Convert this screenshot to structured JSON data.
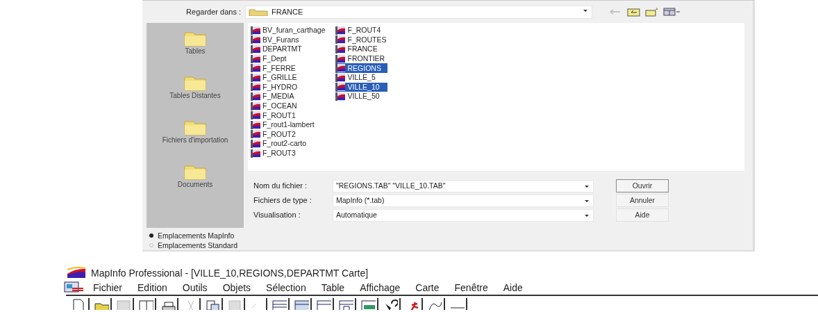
{
  "dialog": {
    "look_in": {
      "label": "Regarder dans :",
      "value": "FRANCE"
    },
    "places": [
      {
        "label": "Tables"
      },
      {
        "label": "Tables Distantes"
      },
      {
        "label": "Fichiers d'importation"
      },
      {
        "label": "Documents"
      }
    ],
    "files": [
      {
        "name": "BV_furan_carthage",
        "selected": false
      },
      {
        "name": "BV_Furans",
        "selected": false
      },
      {
        "name": "DEPARTMT",
        "selected": false
      },
      {
        "name": "F_Dept",
        "selected": false
      },
      {
        "name": "F_FERRE",
        "selected": false
      },
      {
        "name": "F_GRILLE",
        "selected": false
      },
      {
        "name": "F_HYDRO",
        "selected": false
      },
      {
        "name": "F_MEDIA",
        "selected": false
      },
      {
        "name": "F_OCEAN",
        "selected": false
      },
      {
        "name": "F_ROUT1",
        "selected": false
      },
      {
        "name": "F_rout1-lambert",
        "selected": false
      },
      {
        "name": "F_ROUT2",
        "selected": false
      },
      {
        "name": "F_rout2-carto",
        "selected": false
      },
      {
        "name": "F_ROUT3",
        "selected": false
      },
      {
        "name": "F_ROUT4",
        "selected": false
      },
      {
        "name": "F_ROUTES",
        "selected": false
      },
      {
        "name": "FRANCE",
        "selected": false
      },
      {
        "name": "FRONTIER",
        "selected": false
      },
      {
        "name": "REGIONS",
        "selected": true
      },
      {
        "name": "VILLE_5",
        "selected": false
      },
      {
        "name": "VILLE_10",
        "selected": true
      },
      {
        "name": "VILLE_50",
        "selected": false
      }
    ],
    "fields": [
      {
        "label": "Nom du fichier :",
        "value": "\"REGIONS.TAB\" \"VILLE_10.TAB\""
      },
      {
        "label": "Fichiers de type :",
        "value": "MapInfo (*.tab)"
      },
      {
        "label": "Visualisation :",
        "value": "Automatique"
      }
    ],
    "buttons": [
      {
        "label": "Ouvrir",
        "default": true
      },
      {
        "label": "Annuler",
        "default": false
      },
      {
        "label": "Aide",
        "default": false
      }
    ],
    "locations": [
      {
        "label": "Emplacements MapInfo",
        "selected": true
      },
      {
        "label": "Emplacements Standard",
        "selected": false
      }
    ]
  },
  "app": {
    "title": "MapInfo Professional - [VILLE_10,REGIONS,DEPARTMT Carte]",
    "menu": [
      "Fichier",
      "Edition",
      "Outils",
      "Objets",
      "Sélection",
      "Table",
      "Affichage",
      "Carte",
      "Fenêtre",
      "Aide"
    ]
  }
}
